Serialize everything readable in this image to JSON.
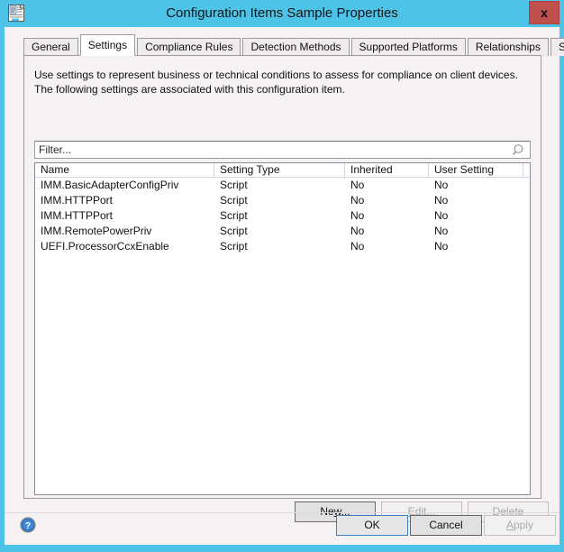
{
  "window": {
    "title": "Configuration Items Sample Properties",
    "icon": "document-properties-icon",
    "close_label": "x",
    "accent_color": "#4ec3e8",
    "close_color": "#c0504d"
  },
  "tabs": [
    {
      "label": "General",
      "selected": false
    },
    {
      "label": "Settings",
      "selected": true
    },
    {
      "label": "Compliance Rules",
      "selected": false
    },
    {
      "label": "Detection Methods",
      "selected": false
    },
    {
      "label": "Supported Platforms",
      "selected": false
    },
    {
      "label": "Relationships",
      "selected": false
    },
    {
      "label": "Security",
      "selected": false
    }
  ],
  "panel": {
    "description": "Use settings to represent business or technical conditions to assess for compliance on client devices. The following settings are associated with this configuration item."
  },
  "filter": {
    "value": "",
    "placeholder": "Filter...",
    "icon": "search-icon"
  },
  "listview": {
    "columns": [
      "Name",
      "Setting Type",
      "Inherited",
      "User Setting"
    ],
    "rows": [
      {
        "name": "IMM.BasicAdapterConfigPriv",
        "setting_type": "Script",
        "inherited": "No",
        "user_setting": "No"
      },
      {
        "name": "IMM.HTTPPort",
        "setting_type": "Script",
        "inherited": "No",
        "user_setting": "No"
      },
      {
        "name": "IMM.HTTPPort",
        "setting_type": "Script",
        "inherited": "No",
        "user_setting": "No"
      },
      {
        "name": "IMM.RemotePowerPriv",
        "setting_type": "Script",
        "inherited": "No",
        "user_setting": "No"
      },
      {
        "name": "UEFI.ProcessorCcxEnable",
        "setting_type": "Script",
        "inherited": "No",
        "user_setting": "No"
      }
    ]
  },
  "item_buttons": {
    "new": {
      "label": "New...",
      "accel_before": "Ne",
      "accel": "w",
      "accel_after": "...",
      "enabled": true
    },
    "edit": {
      "label": "Edit...",
      "accel_before": "",
      "accel": "E",
      "accel_after": "dit...",
      "enabled": false
    },
    "delete": {
      "label": "Delete",
      "accel_before": "Del",
      "accel": "e",
      "accel_after": "te",
      "enabled": false
    }
  },
  "dialog_buttons": {
    "help": {
      "label": "?",
      "icon": "help-icon"
    },
    "ok": {
      "label": "OK",
      "enabled": true,
      "default": true
    },
    "cancel": {
      "label": "Cancel",
      "enabled": true
    },
    "apply": {
      "label": "Apply",
      "accel_before": "",
      "accel": "A",
      "accel_after": "pply",
      "enabled": false
    }
  }
}
